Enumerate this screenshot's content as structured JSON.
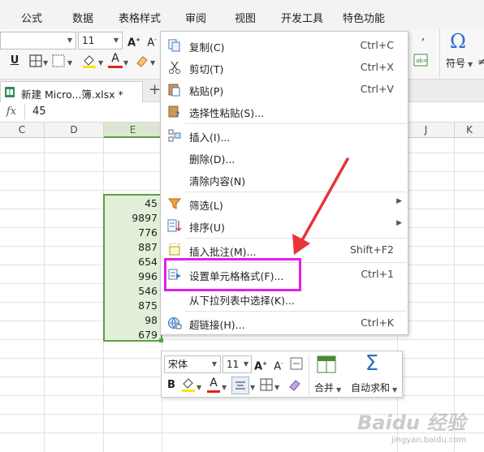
{
  "ribbon_tabs": [
    "公式",
    "数据",
    "表格样式",
    "审阅",
    "视图",
    "开发工具",
    "特色功能"
  ],
  "toolbar": {
    "font_size": "11",
    "symbol_label": "符号",
    "symbol_glyph": "Ω"
  },
  "file_tab": {
    "name": "新建 Micro...簿.xlsx *",
    "new_tab": "+"
  },
  "formula_bar": {
    "fx": "fx",
    "value": "45"
  },
  "columns": [
    "C",
    "D",
    "E",
    "J",
    "K"
  ],
  "cells": [
    "45",
    "9897",
    "776",
    "887",
    "654",
    "996",
    "546",
    "875",
    "98",
    "679"
  ],
  "context_menu": {
    "items": [
      {
        "label": "复制(C)",
        "shortcut": "Ctrl+C",
        "icon": "copy-icon"
      },
      {
        "label": "剪切(T)",
        "shortcut": "Ctrl+X",
        "icon": "scissors-icon"
      },
      {
        "label": "粘贴(P)",
        "shortcut": "Ctrl+V",
        "icon": "paste-icon"
      },
      {
        "label": "选择性粘贴(S)...",
        "shortcut": "",
        "icon": "paste-special-icon"
      },
      {
        "label": "插入(I)...",
        "shortcut": "",
        "icon": "insert-icon"
      },
      {
        "label": "删除(D)...",
        "shortcut": "",
        "icon": ""
      },
      {
        "label": "清除内容(N)",
        "shortcut": "",
        "icon": ""
      },
      {
        "label": "筛选(L)",
        "shortcut": "",
        "icon": "filter-icon",
        "submenu": true
      },
      {
        "label": "排序(U)",
        "shortcut": "",
        "icon": "sort-icon",
        "submenu": true
      },
      {
        "label": "插入批注(M)...",
        "shortcut": "Shift+F2",
        "icon": "comment-icon"
      },
      {
        "label": "设置单元格格式(F)...",
        "shortcut": "Ctrl+1",
        "icon": "format-cells-icon"
      },
      {
        "label": "从下拉列表中选择(K)...",
        "shortcut": "",
        "icon": ""
      },
      {
        "label": "超链接(H)...",
        "shortcut": "Ctrl+K",
        "icon": "hyperlink-icon"
      }
    ]
  },
  "mini_toolbar": {
    "font_name": "宋体",
    "font_size": "11",
    "merge_label": "合并",
    "autosum_label": "自动求和",
    "sigma": "Σ"
  },
  "watermark": {
    "main": "Baidu 经验",
    "sub": "jingyan.baidu.com"
  },
  "colors": {
    "selection_border": "#5f9f43",
    "selection_fill": "#e2f0d9",
    "annotation": "#e020e8",
    "arrow": "#e8343a",
    "font_color_red": "#e02020",
    "fill_yellow": "#ffe600",
    "symbol_blue": "#2b6cc4"
  }
}
